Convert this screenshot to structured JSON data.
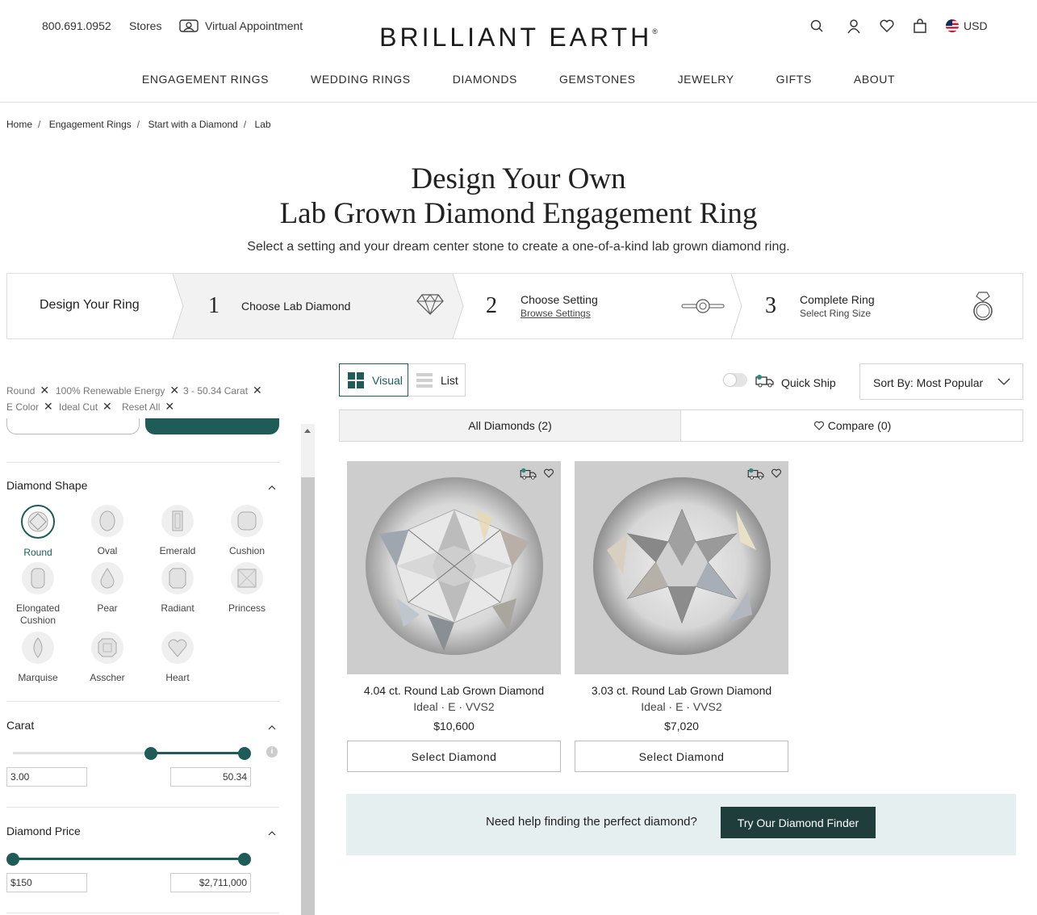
{
  "header": {
    "phone": "800.691.0952",
    "stores": "Stores",
    "virtual_appointment": "Virtual Appointment",
    "logo": "BRILLIANT EARTH",
    "logo_mark": "®",
    "currency": "USD",
    "icons": [
      "search-icon",
      "account-icon",
      "heart-icon",
      "bag-icon",
      "us-flag-icon"
    ]
  },
  "nav": [
    "ENGAGEMENT RINGS",
    "WEDDING RINGS",
    "DIAMONDS",
    "GEMSTONES",
    "JEWELRY",
    "GIFTS",
    "ABOUT"
  ],
  "breadcrumb": [
    "Home",
    "Engagement Rings",
    "Start with a Diamond",
    "Lab"
  ],
  "hero": {
    "title_line1": "Design Your Own",
    "title_line2": "Lab Grown Diamond Engagement Ring",
    "subtitle": "Select a setting and your dream center stone to create a one-of-a-kind lab grown diamond ring."
  },
  "steps": {
    "label": "Design Your Ring",
    "items": [
      {
        "num": "1",
        "title": "Choose Lab Diamond",
        "sub": "",
        "icon": "diamond-icon"
      },
      {
        "num": "2",
        "title": "Choose Setting",
        "sub": "Browse Settings",
        "icon": "ring-setting-icon"
      },
      {
        "num": "3",
        "title": "Complete Ring",
        "sub": "Select Ring Size",
        "icon": "ring-icon"
      }
    ]
  },
  "filters": {
    "chips": [
      "Round",
      "100% Renewable Energy",
      "3 - 50.34 Carat",
      "E Color",
      "Ideal Cut",
      "Reset All"
    ],
    "shape_title": "Diamond Shape",
    "shapes": [
      "Round",
      "Oval",
      "Emerald",
      "Cushion",
      "Elongated Cushion",
      "Pear",
      "Radiant",
      "Princess",
      "Marquise",
      "Asscher",
      "Heart"
    ],
    "selected_shape": "Round",
    "carat": {
      "title": "Carat",
      "min": "3.00",
      "max": "50.34"
    },
    "price": {
      "title": "Diamond Price",
      "min": "$150",
      "max": "$2,711,000"
    }
  },
  "results": {
    "view_visual": "Visual",
    "view_list": "List",
    "quick_ship": "Quick Ship",
    "sort": "Sort By: Most Popular",
    "tab_all": "All Diamonds (2)",
    "tab_compare": "Compare (0)",
    "cards": [
      {
        "name": "4.04 ct. Round Lab Grown Diamond",
        "spec": "Ideal · E · VVS2",
        "price": "$10,600",
        "button": "Select Diamond"
      },
      {
        "name": "3.03 ct. Round Lab Grown Diamond",
        "spec": "Ideal · E · VVS2",
        "price": "$7,020",
        "button": "Select Diamond"
      }
    ],
    "help_text": "Need help finding the perfect diamond?",
    "help_button": "Try Our Diamond Finder"
  },
  "colors": {
    "accent": "#1f5b57",
    "help_bg": "#e6efef"
  }
}
